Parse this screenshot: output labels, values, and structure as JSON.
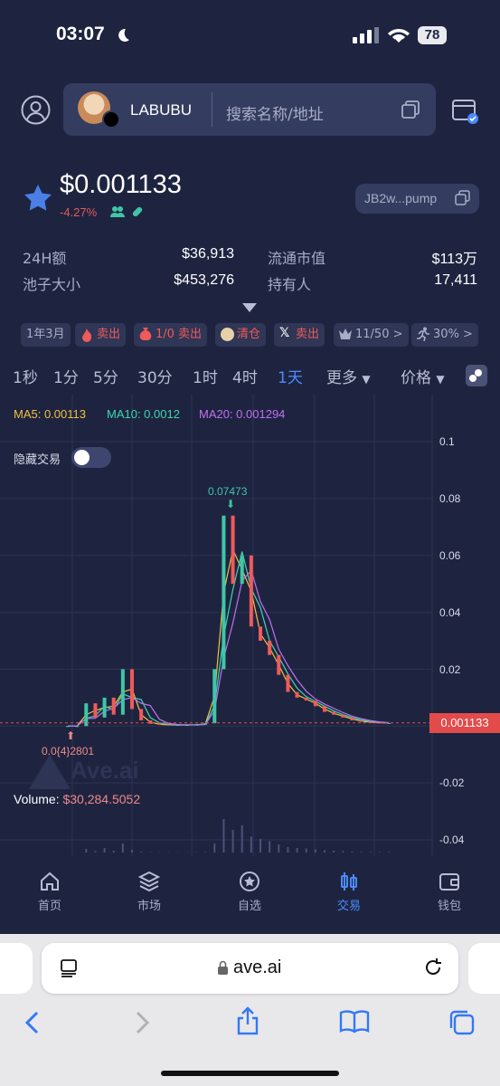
{
  "status": {
    "time": "03:07",
    "battery": "78"
  },
  "header": {
    "token_name": "LABUBU",
    "search_placeholder": "搜索名称/地址"
  },
  "price": {
    "value": "$0.001133",
    "change": "-4.27%",
    "address": "JB2w...pump"
  },
  "stats": {
    "vol_label": "24H额",
    "vol_value": "$36,913",
    "mcap_label": "流通市值",
    "mcap_value": "$113万",
    "pool_label": "池子大小",
    "pool_value": "$453,276",
    "holders_label": "持有人",
    "holders_value": "17,411"
  },
  "tags": [
    {
      "text": "1年3月"
    },
    {
      "text": "卖出"
    },
    {
      "text": "1/0 卖出"
    },
    {
      "text": "清仓"
    },
    {
      "text": "卖出"
    },
    {
      "text": "11/50 >"
    },
    {
      "text": "30% >"
    }
  ],
  "intervals": [
    "1秒",
    "1分",
    "5分",
    "30分",
    "1时",
    "4时",
    "1天"
  ],
  "active_interval": "1天",
  "more_label": "更多",
  "price_label": "价格",
  "chart": {
    "ma5": "MA5: 0.00113",
    "ma10": "MA10: 0.0012",
    "ma20": "MA20: 0.001294",
    "hide_trades": "隐藏交易",
    "high_label": "0.07473",
    "low_label": "0.0{4}2801",
    "current_price": "0.001133",
    "volume_label": "Volume: ",
    "volume_value": "$30,284.5052",
    "watermark": "Ave.ai",
    "yticks": [
      "0.1",
      "0.08",
      "0.06",
      "0.04",
      "0.02",
      "-0.02",
      "-0.04"
    ]
  },
  "chart_data": {
    "type": "line",
    "y_ticks": [
      0.1,
      0.08,
      0.06,
      0.04,
      0.02,
      -0.02,
      -0.04
    ],
    "ylim": [
      -0.04,
      0.1
    ],
    "high": 0.07473,
    "current": 0.001133,
    "series": [
      {
        "name": "MA5",
        "value": 0.00113
      },
      {
        "name": "MA10",
        "value": 0.0012
      },
      {
        "name": "MA20",
        "value": 0.001294
      }
    ],
    "price_path": [
      0.0,
      0.0,
      0.008,
      0.003,
      0.01,
      0.004,
      0.02,
      0.006,
      0.002,
      0.0008,
      0.0005,
      0.0004,
      0.0004,
      0.0004,
      0.0005,
      0.001,
      0.02,
      0.074,
      0.05,
      0.06,
      0.035,
      0.03,
      0.025,
      0.018,
      0.012,
      0.01,
      0.009,
      0.007,
      0.005,
      0.004,
      0.003,
      0.002,
      0.0015,
      0.0012,
      0.0011,
      0.0011
    ]
  },
  "nav": [
    {
      "label": "首页",
      "icon": "home-icon"
    },
    {
      "label": "市场",
      "icon": "layers-icon"
    },
    {
      "label": "自选",
      "icon": "star-icon"
    },
    {
      "label": "交易",
      "icon": "candles-icon"
    },
    {
      "label": "钱包",
      "icon": "wallet-icon"
    }
  ],
  "browser": {
    "url": "ave.ai"
  },
  "colors": {
    "accent": "#4a8bff",
    "down": "#e05a5a",
    "up": "#3fc6a6",
    "ma5": "#f0c040",
    "ma10": "#3fd6b0",
    "ma20": "#c070f0"
  }
}
